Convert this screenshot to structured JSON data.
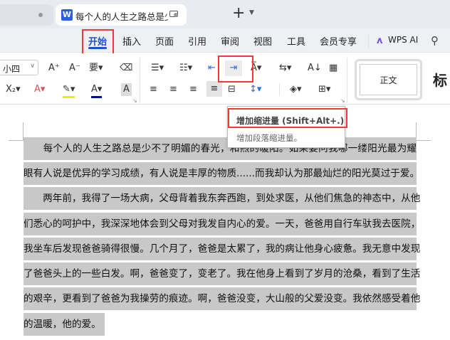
{
  "tabs": {
    "active_title": "每个人的人生之路总是少不了明",
    "app_letter": "W",
    "new_tab": "+"
  },
  "menu": {
    "items": [
      "开始",
      "插入",
      "页面",
      "引用",
      "审阅",
      "视图",
      "工具",
      "会员专享"
    ],
    "ai": "WPS AI"
  },
  "toolbar": {
    "font_size": "小四",
    "styles": {
      "normal": "正文",
      "heading": "标"
    },
    "shading_letter": "A"
  },
  "tooltip": {
    "title": "增加缩进量 (Shift+Alt+.)",
    "description": "增加段落缩进量。"
  },
  "document": {
    "lines": [
      "　　每个人的人生之路总是少不了明媚的春光，和煦的暖阳。如果要问我哪一缕阳光最为耀",
      "眼有人说是优异的学习成绩，有人说是丰厚的物质......而我却认为那最灿烂的阳光莫过于爱。",
      "　　两年前，我得了一场大病，父母背着我东奔西跑，到处求医，从他们焦急的神态中，从他",
      "们悉心的呵护中，我深深地体会到父母对我发自内心的爱。一天，爸爸用自行车驮我去医院，",
      "我坐车后发现爸爸骑得很慢。几个月了，爸爸是太累了，我的病让他身心疲惫。我无意中发现",
      "了爸爸头上的一些白发。啊，爸爸变了，变老了。我在他身上看到了岁月的沧桑，看到了生活",
      "的艰辛，更看到了爸爸为我操劳的痕迹。啊，爸爸没变，大山般的父爱没变。我依然感受着他",
      "的温暖，他的爱。"
    ]
  },
  "colors": {
    "accent": "#2050d0",
    "highlight_box": "#f03a3a",
    "selection": "#c8c8c8"
  }
}
